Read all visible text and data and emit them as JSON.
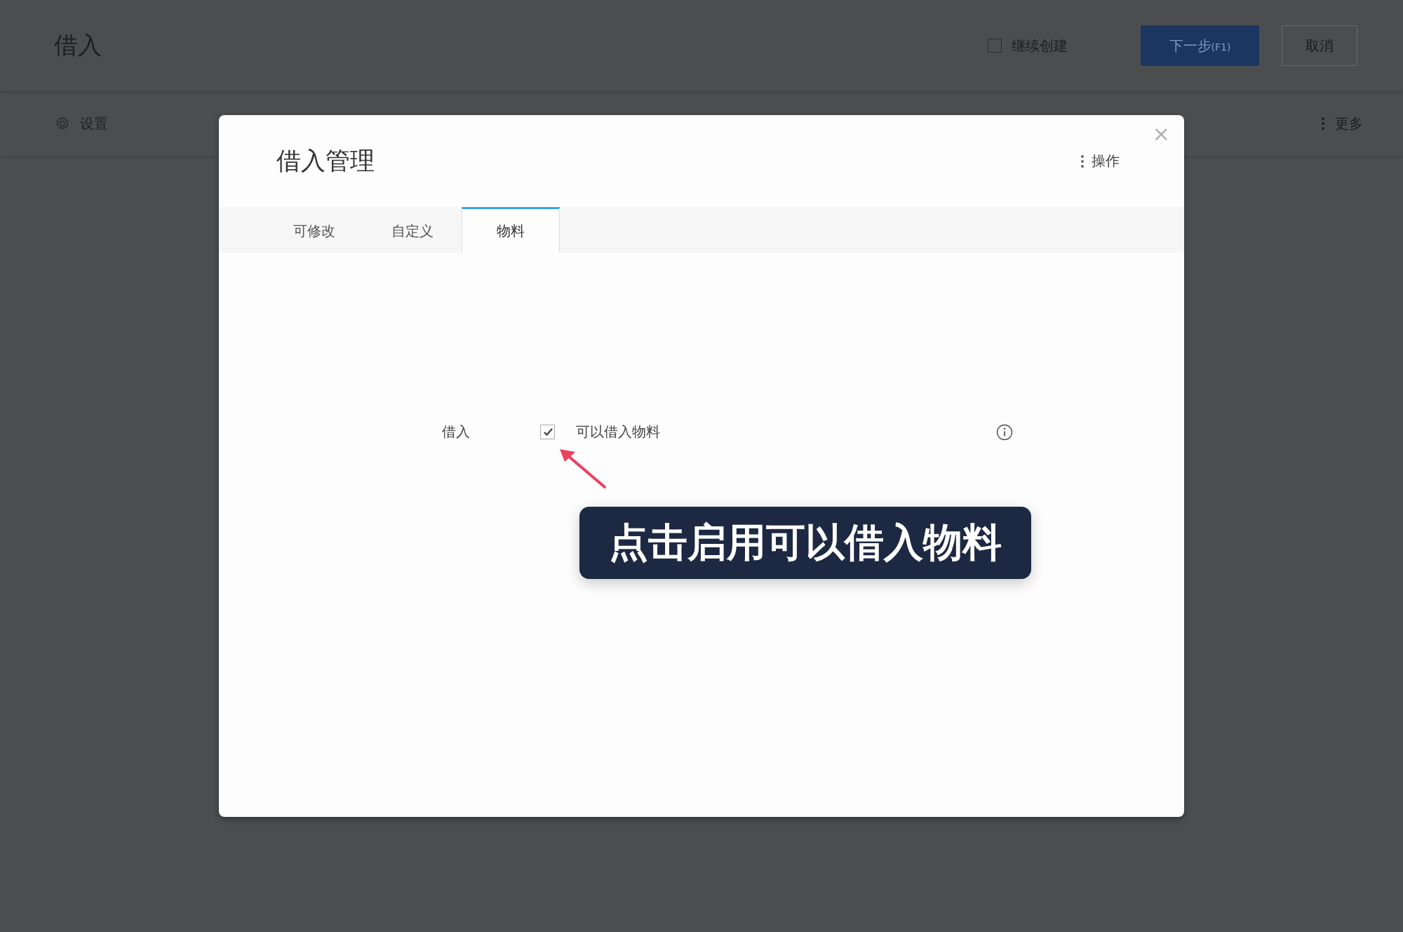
{
  "page": {
    "title": "借入",
    "continue_create": {
      "label": "继续创建",
      "checked": false
    },
    "buttons": [
      {
        "label": "下一步",
        "shortcut": "(F1)",
        "kind": "primary"
      },
      {
        "label": "取消",
        "kind": "secondary"
      }
    ],
    "toolbar": {
      "settings": "设置",
      "more": "更多"
    }
  },
  "dialog": {
    "title": "借入管理",
    "actions": "操作",
    "close": "×",
    "tabs": [
      {
        "label": "可修改",
        "selected": false
      },
      {
        "label": "自定义",
        "selected": false
      },
      {
        "label": "物料",
        "selected": true
      }
    ],
    "fields": [
      {
        "label": "借入",
        "checked": true,
        "text": "可以借入物料"
      }
    ]
  },
  "callout": {
    "text": "点击启用可以借入物料"
  }
}
